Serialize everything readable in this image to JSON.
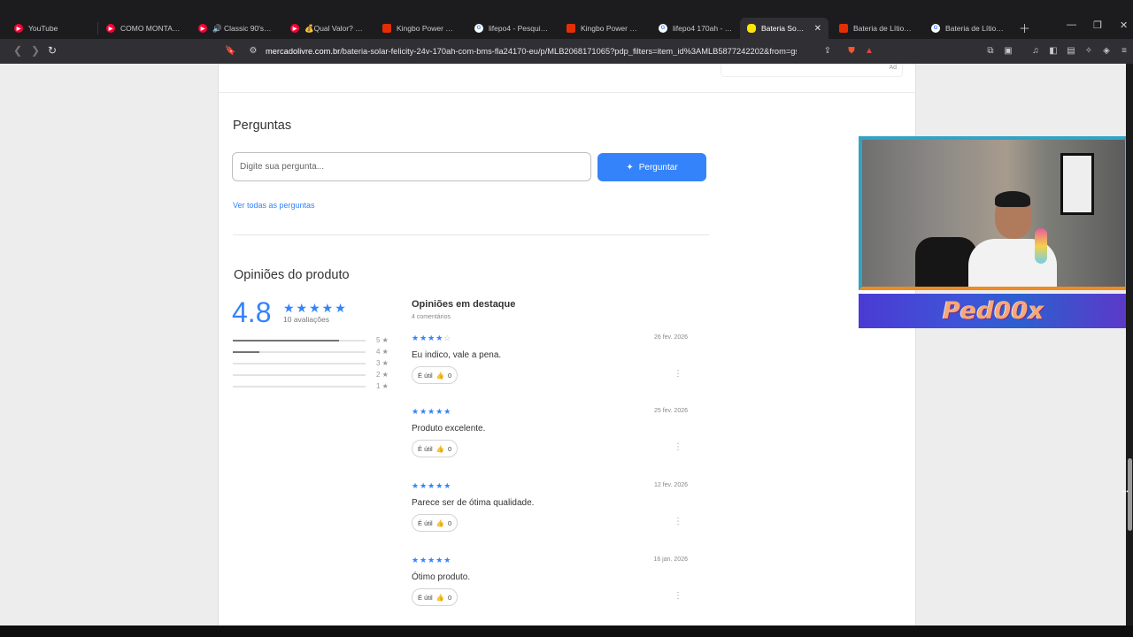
{
  "browser": {
    "tabs": [
      {
        "title": "YouTube",
        "icon": "youtube-icon",
        "color": "#ff0033"
      },
      {
        "title": "COMO MONTAR UM",
        "icon": "youtube-icon",
        "color": "#ff0033"
      },
      {
        "title": "🔊 Classic 90's-2000",
        "icon": "youtube-icon",
        "color": "#ff0033"
      },
      {
        "title": "💰Qual Valor? KIT C",
        "icon": "youtube-icon",
        "color": "#ff0033"
      },
      {
        "title": "Kingbo Power 12.8V",
        "icon": "aliexpress-icon",
        "color": "#e62e04"
      },
      {
        "title": "lifepo4 - Pesquisa G",
        "icon": "google-icon",
        "color": "#4285f4"
      },
      {
        "title": "Kingbo Power 24V 1",
        "icon": "aliexpress-icon",
        "color": "#e62e04"
      },
      {
        "title": "lifepo4 170ah - Pesq",
        "icon": "google-icon",
        "color": "#4285f4"
      },
      {
        "title": "Bateria Solar Lití",
        "icon": "mercadolivre-icon",
        "color": "#ffe600",
        "active": true
      },
      {
        "title": "Bateria de Lítio Felic",
        "icon": "aliexpress-icon",
        "color": "#e62e04"
      },
      {
        "title": "Bateria de Lítio Felic",
        "icon": "google-icon",
        "color": "#4285f4"
      }
    ],
    "url_domain": "mercadolivre.com.br",
    "url_path": "/bateria-solar-felicity-24v-170ah-com-bms-fla24170-eu/p/MLB2068171065?pdp_filters=item_id%3AMLB5877242202&from=gsh..."
  },
  "page": {
    "ad_label": "Ad",
    "questions": {
      "title": "Perguntas",
      "input_placeholder": "Digite sua pergunta...",
      "ask_button": "Perguntar",
      "see_all_link": "Ver todas as perguntas"
    },
    "reviews": {
      "title": "Opiniões do produto",
      "average": "4.8",
      "total_label": "10 avaliações",
      "distribution": [
        {
          "label": "5",
          "fraction": 0.8
        },
        {
          "label": "4",
          "fraction": 0.2
        },
        {
          "label": "3",
          "fraction": 0
        },
        {
          "label": "2",
          "fraction": 0
        },
        {
          "label": "1",
          "fraction": 0
        }
      ],
      "featured_title": "Opiniões em destaque",
      "featured_subtitle": "4 comentários",
      "useful_label": "É útil",
      "items": [
        {
          "rating": 4,
          "date": "26 fev. 2026",
          "text": "Eu indico, vale a pena.",
          "useful_count": "0"
        },
        {
          "rating": 5,
          "date": "25 fev. 2026",
          "text": "Produto excelente.",
          "useful_count": "0"
        },
        {
          "rating": 5,
          "date": "12 fev. 2026",
          "text": "Parece ser de ótima qualidade.",
          "useful_count": "0"
        },
        {
          "rating": 5,
          "date": "16 jan. 2026",
          "text": "Ótimo produto.",
          "useful_count": "0"
        }
      ]
    }
  },
  "overlay": {
    "streamer_logo_text": "Ped00x"
  },
  "colors": {
    "accent": "#3483fa",
    "cam_border_left": "#31a3c7",
    "cam_border_right": "#f08a22"
  }
}
